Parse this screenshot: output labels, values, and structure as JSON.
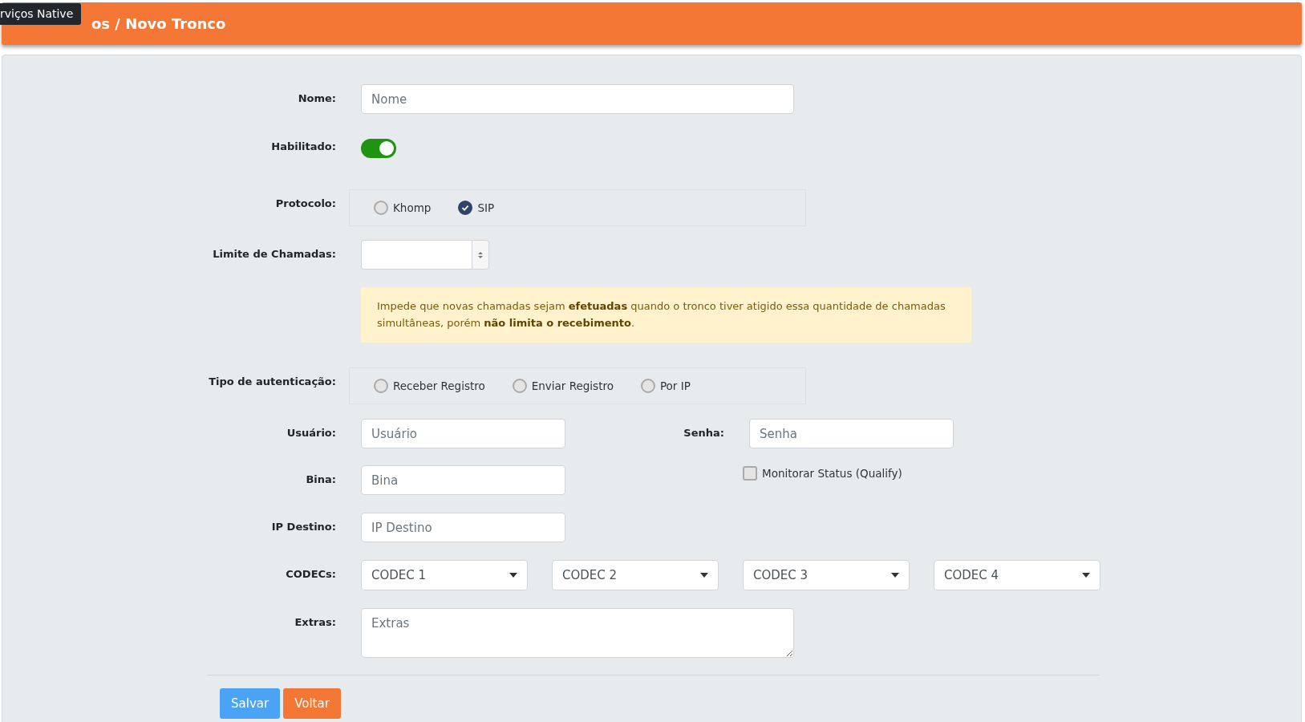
{
  "header": {
    "tooltip": "rviços Native",
    "title": "os / Novo Tronco"
  },
  "nome": {
    "label": "Nome:",
    "placeholder": "Nome"
  },
  "habilitado": {
    "label": "Habilitado:",
    "on": true
  },
  "protocolo": {
    "label": "Protocolo:",
    "options": [
      {
        "label": "Khomp",
        "selected": false
      },
      {
        "label": "SIP",
        "selected": true
      }
    ]
  },
  "limite": {
    "label": "Limite de Chamadas:"
  },
  "alert": "Impede que novas chamadas sejam **efetuadas** quando o tronco tiver atigido essa quantidade de chamadas simultâneas, porém **não limita o recebimento**.",
  "autenticacao": {
    "label": "Tipo de autenticação:",
    "options": [
      {
        "label": "Receber Registro",
        "selected": false
      },
      {
        "label": "Enviar Registro",
        "selected": false
      },
      {
        "label": "Por IP",
        "selected": false
      }
    ]
  },
  "usuario": {
    "label": "Usuário:",
    "placeholder": "Usuário"
  },
  "senha": {
    "label": "Senha:",
    "placeholder": "Senha"
  },
  "bina": {
    "label": "Bina:",
    "placeholder": "Bina"
  },
  "qualify": {
    "label": "Monitorar Status (Qualify)",
    "checked": false
  },
  "ip_destino": {
    "label": "IP Destino:",
    "placeholder": "IP Destino"
  },
  "codecs": {
    "label": "CODECs:",
    "selects": [
      "CODEC 1",
      "CODEC 2",
      "CODEC 3",
      "CODEC 4"
    ]
  },
  "extras": {
    "label": "Extras:",
    "placeholder": "Extras"
  },
  "buttons": [
    {
      "label": "Salvar",
      "kind": "primary"
    },
    {
      "label": "Voltar",
      "kind": "secondary"
    }
  ]
}
